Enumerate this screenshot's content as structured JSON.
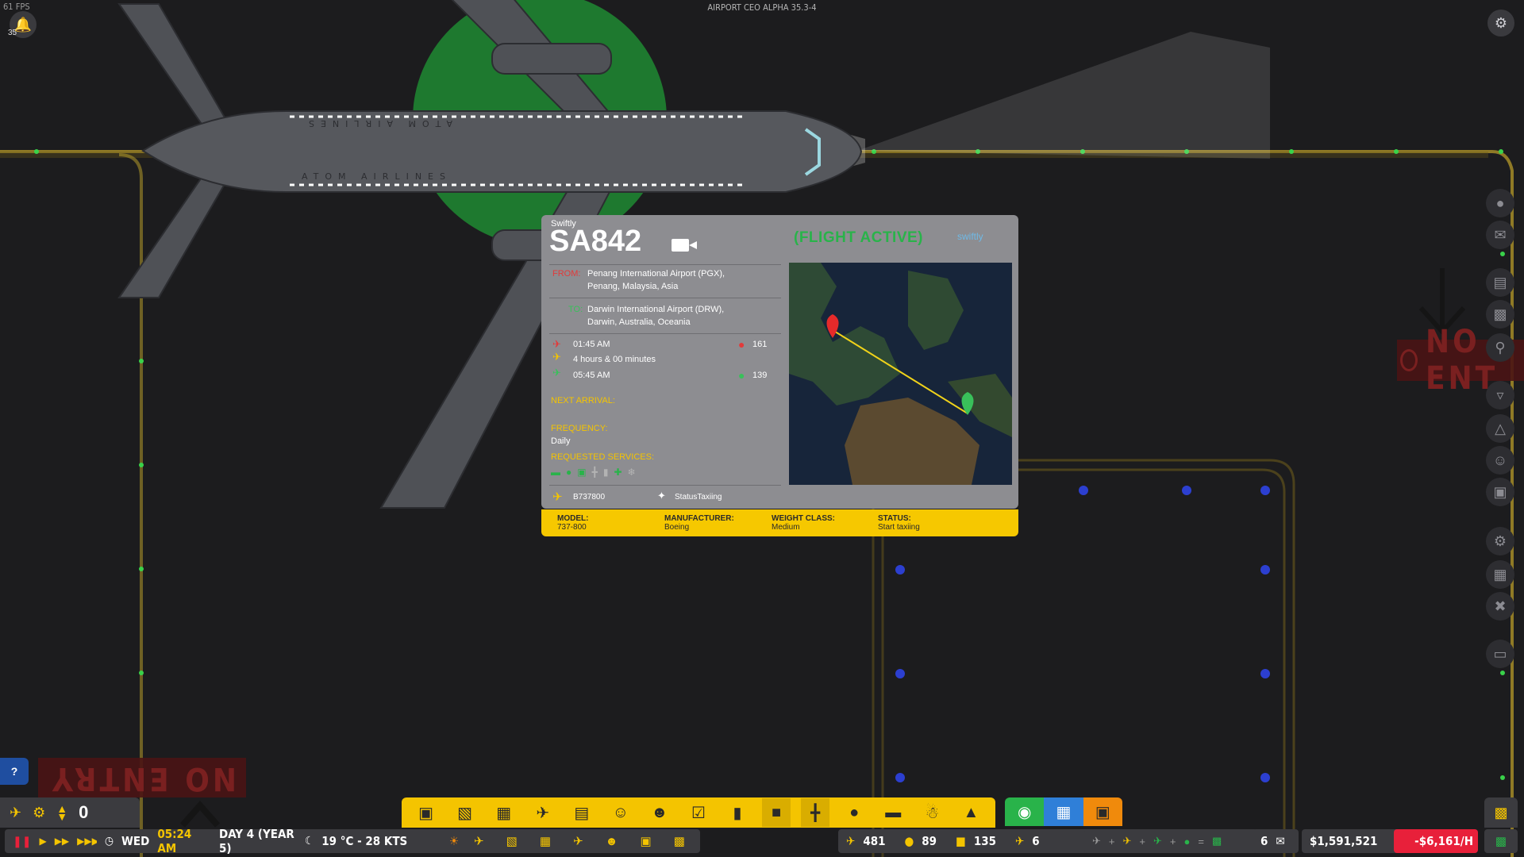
{
  "hud": {
    "fps": "61 FPS",
    "version": "AIRPORT CEO ALPHA 35.3-4",
    "notification_count": "35",
    "help_label": "?"
  },
  "signs": {
    "no_entry_bottom": "NO ENTRY",
    "no_entry_right": "NO ENT"
  },
  "plane": {
    "livery_top": "ATOM AIRLINES",
    "livery_bottom": "ATOM AIRLINES"
  },
  "flight": {
    "airline": "Swiftly",
    "number": "SA842",
    "status_banner": "(FLIGHT ACTIVE)",
    "airline_logo": "swiftly",
    "from_label": "FROM:",
    "from_line1": "Penang International Airport (PGX),",
    "from_line2": "Penang, Malaysia, Asia",
    "to_label": "TO:",
    "to_line1": "Darwin International Airport (DRW),",
    "to_line2": "Darwin, Australia, Oceania",
    "departure_time": "01:45 AM",
    "duration": "4 hours & 00 minutes",
    "arrival_time": "05:45 AM",
    "departure_pax": "161",
    "arrival_pax": "139",
    "next_arrival_label": "NEXT ARRIVAL:",
    "frequency_label": "FREQUENCY:",
    "frequency_value": "Daily",
    "services_label": "REQUESTED SERVICES:",
    "aircraft_code": "B737800",
    "ground_status": "StatusTaxiing",
    "model_label": "MODEL:",
    "model_value": "737-800",
    "manufacturer_label": "MANUFACTURER:",
    "manufacturer_value": "Boeing",
    "weight_label": "WEIGHT CLASS:",
    "weight_value": "Medium",
    "status_label": "STATUS:",
    "status_value": "Start taxiing"
  },
  "left_panel": {
    "counter": "0"
  },
  "bottom_bar": {
    "day_name": "WED",
    "time": "05:24 AM",
    "day": "DAY 4 (YEAR 5)",
    "weather": "19 °C - 28 KTS",
    "stat_flights": "481",
    "stat_pax": "89",
    "stat_bags": "135",
    "stat_planes": "6",
    "mail_count": "6",
    "money": "$1,591,521",
    "income_rate": "-$6,161/H"
  },
  "icons": {
    "pause": "pause-icon",
    "play": "play-icon",
    "settings": "gear-icon",
    "camera": "video-camera-icon"
  },
  "colors": {
    "accent_yellow": "#f6c800",
    "active_green": "#29b34a",
    "negative_red": "#e8203a",
    "panel_grey": "#8d8d91"
  }
}
